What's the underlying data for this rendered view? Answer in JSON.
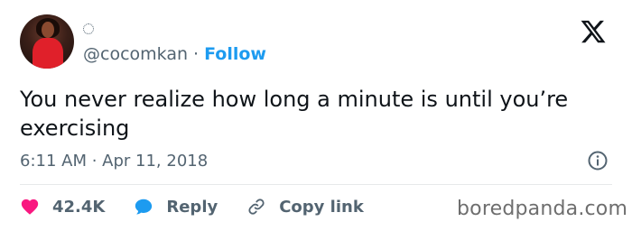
{
  "tweet": {
    "handle": "@cocomkan",
    "separator": "·",
    "follow_label": "Follow",
    "text": "You never realize how long a minute is until you’re exercising",
    "timestamp": "6:11 AM · Apr 11, 2018"
  },
  "actions": {
    "likes_count": "42.4K",
    "reply_label": "Reply",
    "copy_link_label": "Copy link"
  },
  "icons": {
    "logo": "x-logo-icon",
    "info": "info-icon",
    "like": "heart-icon",
    "reply": "speech-bubble-icon",
    "copy": "link-icon"
  },
  "colors": {
    "accent": "#1d9bf0",
    "like": "#f91880",
    "muted": "#536471",
    "text": "#0f1419"
  },
  "watermark": "boredpanda.com"
}
